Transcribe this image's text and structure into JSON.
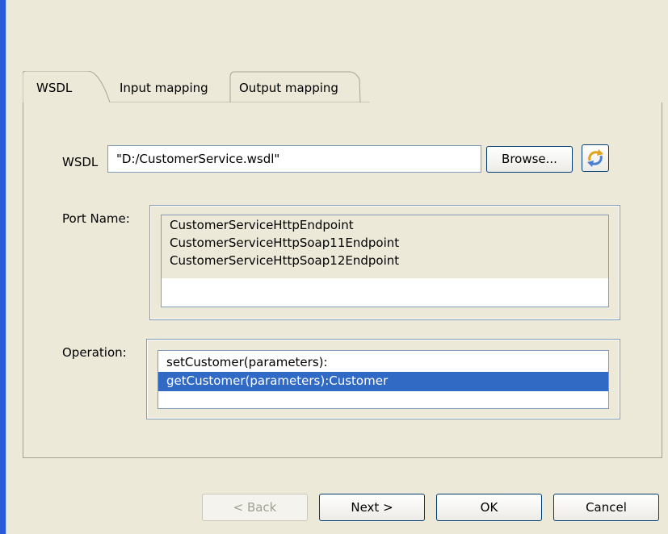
{
  "tabs": [
    {
      "label": "WSDL",
      "active": true
    },
    {
      "label": "Input mapping",
      "active": false
    },
    {
      "label": "Output mapping",
      "active": false
    }
  ],
  "wsdl": {
    "label": "WSDL",
    "value": "\"D:/CustomerService.wsdl\"",
    "browse_label": "Browse...",
    "refresh_icon": "refresh-icon"
  },
  "port": {
    "label": "Port Name:",
    "items": [
      "CustomerServiceHttpEndpoint",
      "CustomerServiceHttpSoap11Endpoint",
      "CustomerServiceHttpSoap12Endpoint"
    ]
  },
  "operation": {
    "label": "Operation:",
    "items": [
      "setCustomer(parameters):",
      "getCustomer(parameters):Customer"
    ],
    "selected_index": 1
  },
  "buttons": {
    "back": "< Back",
    "next": "Next >",
    "ok": "OK",
    "cancel": "Cancel"
  },
  "colors": {
    "window_border": "#2a5bd7",
    "selection": "#316ac5",
    "dialog_bg": "#ece9d8"
  }
}
